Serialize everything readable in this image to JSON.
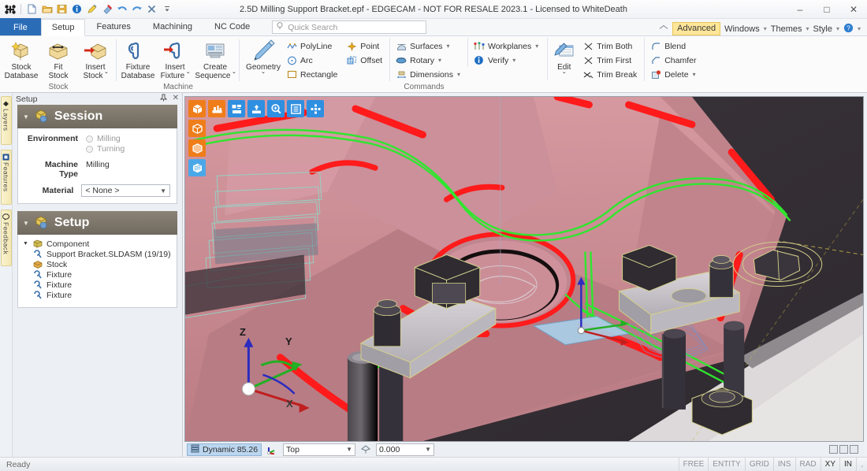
{
  "window": {
    "title": "2.5D Milling Support Bracket.epf - EDGECAM - NOT FOR RESALE 2023.1  - Licensed to WhiteDeath",
    "minimize": "–",
    "maximize": "□",
    "close": "✕"
  },
  "quick_access": [
    {
      "name": "app-menu-icon",
      "label": "EDGECAM"
    },
    {
      "name": "new-icon",
      "label": "New"
    },
    {
      "name": "open-icon",
      "label": "Open"
    },
    {
      "name": "save-icon",
      "label": "Save"
    },
    {
      "name": "info-icon",
      "label": "Info"
    },
    {
      "name": "highlight-icon",
      "label": "Highlight"
    },
    {
      "name": "pin-icon",
      "label": "Pin"
    },
    {
      "name": "undo-icon",
      "label": "Undo"
    },
    {
      "name": "redo-icon",
      "label": "Redo"
    },
    {
      "name": "delete-icon",
      "label": "Delete"
    },
    {
      "name": "customize-icon",
      "label": "Customize Quick Access Toolbar"
    }
  ],
  "ribbon": {
    "tabs": [
      {
        "label": "File",
        "active": false,
        "file": true
      },
      {
        "label": "Setup",
        "active": true,
        "file": false
      },
      {
        "label": "Features",
        "active": false,
        "file": false
      },
      {
        "label": "Machining",
        "active": false,
        "file": false
      },
      {
        "label": "NC Code",
        "active": false,
        "file": false
      }
    ],
    "search_placeholder": "Quick Search",
    "right_items": [
      {
        "label": "Advanced",
        "chip": true
      },
      {
        "label": "Windows",
        "chip": false
      },
      {
        "label": "Themes",
        "chip": false
      },
      {
        "label": "Style",
        "chip": false
      }
    ],
    "help_label": "Help",
    "groups": [
      {
        "title": "Stock",
        "big_buttons": [
          {
            "line1": "Stock",
            "line2": "Database",
            "icon": "stock-database-icon"
          },
          {
            "line1": "Fit",
            "line2": "Stock",
            "icon": "fit-stock-icon"
          },
          {
            "line1": "Insert",
            "line2": "Stock ˇ",
            "icon": "insert-stock-icon"
          }
        ]
      },
      {
        "title": "Machine",
        "big_buttons": [
          {
            "line1": "Fixture",
            "line2": "Database",
            "icon": "fixture-database-icon"
          },
          {
            "line1": "Insert",
            "line2": "Fixture ˇ",
            "icon": "insert-fixture-icon"
          },
          {
            "line1": "Create",
            "line2": "Sequence ˇ",
            "icon": "create-sequence-icon"
          }
        ]
      },
      {
        "title": "Commands",
        "big_buttons": [
          {
            "line1": "Geometry",
            "line2": "ˇ",
            "icon": "geometry-pencil-icon"
          }
        ],
        "columns": [
          [
            {
              "label": "PolyLine",
              "icon": "polyline-icon",
              "caret": false
            },
            {
              "label": "Arc",
              "icon": "arc-icon",
              "caret": false
            },
            {
              "label": "Rectangle",
              "icon": "rectangle-icon",
              "caret": false
            }
          ],
          [
            {
              "label": "Point",
              "icon": "point-icon",
              "caret": false
            },
            {
              "label": "Offset",
              "icon": "offset-icon",
              "caret": false
            }
          ],
          [
            {
              "label": "Surfaces",
              "icon": "surfaces-icon",
              "caret": true
            },
            {
              "label": "Rotary",
              "icon": "rotary-icon",
              "caret": true
            },
            {
              "label": "Dimensions",
              "icon": "dimensions-icon",
              "caret": true
            }
          ],
          [
            {
              "label": "Workplanes",
              "icon": "workplanes-icon",
              "caret": true
            },
            {
              "label": "Verify",
              "icon": "verify-icon",
              "caret": true
            }
          ]
        ],
        "edit_button": {
          "line1": "Edit",
          "line2": "ˇ",
          "icon": "edit-icon"
        },
        "trim_column": [
          {
            "label": "Trim Both",
            "icon": "trim-both-icon",
            "caret": false
          },
          {
            "label": "Trim First",
            "icon": "trim-first-icon",
            "caret": false
          },
          {
            "label": "Trim Break",
            "icon": "trim-break-icon",
            "caret": false
          }
        ],
        "blend_column": [
          {
            "label": "Blend",
            "icon": "blend-icon",
            "caret": false
          },
          {
            "label": "Chamfer",
            "icon": "chamfer-icon",
            "caret": false
          },
          {
            "label": "Delete",
            "icon": "delete-red-icon",
            "caret": true
          }
        ]
      }
    ]
  },
  "side_tabs": [
    {
      "label": "Layers",
      "icon": "layers-icon"
    },
    {
      "label": "Features",
      "icon": "features-icon"
    },
    {
      "label": "Feedback",
      "icon": "feedback-icon"
    }
  ],
  "panel": {
    "title": "Setup",
    "pin_icon": "✀",
    "close_icon": "✕",
    "session": {
      "header": "Session",
      "header_icon": "session-cube-icon",
      "environment_label": "Environment",
      "environment_options": [
        {
          "label": "Milling",
          "selected": false
        },
        {
          "label": "Turning",
          "selected": false
        }
      ],
      "machine_type_label": "Machine Type",
      "machine_type_value": "Milling",
      "material_label": "Material",
      "material_value": "< None >"
    },
    "setup": {
      "header": "Setup",
      "header_icon": "setup-cube-icon",
      "tree": [
        {
          "label": "Component",
          "icon": "component-folder-icon",
          "level": 0,
          "expanded": true
        },
        {
          "label": "Support Bracket.SLDASM (19/19)",
          "icon": "solid-part-icon",
          "level": 1,
          "expanded": false
        },
        {
          "label": "Stock",
          "icon": "stock-box-icon",
          "level": 1,
          "expanded": false
        },
        {
          "label": "Fixture",
          "icon": "fixture-clamp-icon",
          "level": 1,
          "expanded": false
        },
        {
          "label": "Fixture",
          "icon": "fixture-clamp-icon",
          "level": 1,
          "expanded": false
        },
        {
          "label": "Fixture",
          "icon": "fixture-clamp-icon",
          "level": 1,
          "expanded": false
        }
      ]
    }
  },
  "viewport": {
    "toolbar_row": [
      {
        "name": "shaded-view-button",
        "color": "orange",
        "icon": "cube-solid-icon"
      },
      {
        "name": "machine-view-button",
        "color": "orange",
        "icon": "machine-bed-icon"
      },
      {
        "name": "simulate-button",
        "color": "blue",
        "icon": "simulate-icon"
      },
      {
        "name": "tool-up-button",
        "color": "blue",
        "icon": "tool-up-icon"
      },
      {
        "name": "zoom-button",
        "color": "blue",
        "icon": "zoom-in-icon"
      },
      {
        "name": "list-button",
        "color": "blue",
        "icon": "list-icon"
      },
      {
        "name": "move-button",
        "color": "blue",
        "icon": "move-pad-icon"
      }
    ],
    "toolbar_col": [
      {
        "name": "wireframe-view-button",
        "color": "orange",
        "icon": "cube-wire-icon"
      },
      {
        "name": "transparent-view-button",
        "color": "orange",
        "icon": "cube-transparent-icon"
      },
      {
        "name": "section-view-button",
        "color": "lblue",
        "icon": "cube-section-icon"
      }
    ],
    "axis_labels": {
      "x": "X",
      "y": "Y",
      "z": "Z"
    },
    "status": {
      "mode": "Dynamic 85.26",
      "mode_icon": "dynamic-icon",
      "view_icon": "view-axis-icon",
      "view_value": "Top",
      "level_icon": "level-icon",
      "level_value": "0.000"
    },
    "window_buttons": [
      "restore-down-icon",
      "tile-icon",
      "close-view-icon"
    ]
  },
  "statusbar": {
    "ready": "Ready",
    "segments": [
      {
        "label": "FREE",
        "on": false
      },
      {
        "label": "ENTITY",
        "on": false
      },
      {
        "label": "GRID",
        "on": false
      },
      {
        "label": "INS",
        "on": false
      },
      {
        "label": "RAD",
        "on": false
      },
      {
        "label": "XY",
        "on": true
      },
      {
        "label": "IN",
        "on": true
      }
    ]
  },
  "colors": {
    "accent_blue": "#2b6cb7",
    "ribbon_chip": "#ffe699",
    "toolpath_green": "#2fe62f",
    "edge_red": "#ff1b1b",
    "part_pink": "#d99aa0",
    "machine_bed": "#3a3439",
    "panel_header": "#7b746a"
  }
}
